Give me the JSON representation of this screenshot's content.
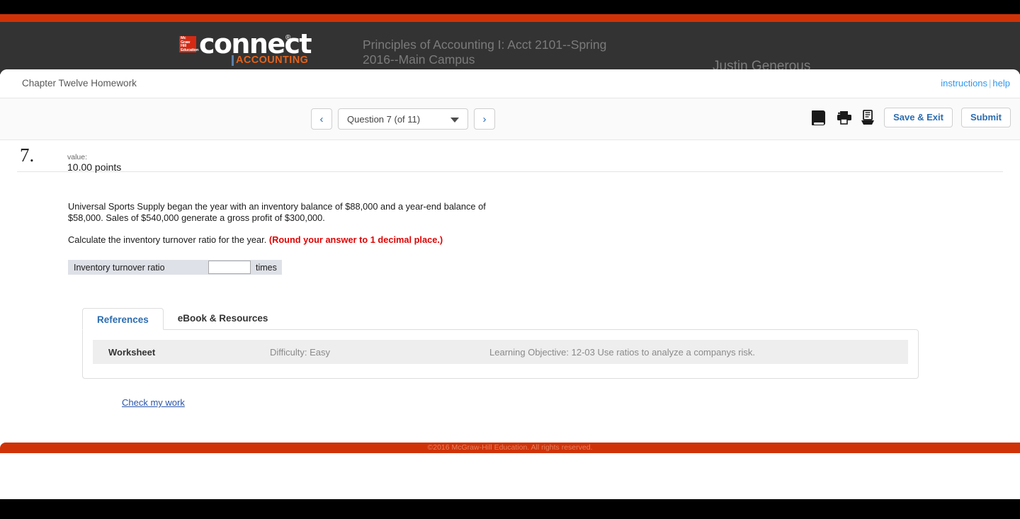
{
  "brand": {
    "publisher_badge": "McGrawHillEducation",
    "product_name": "connect",
    "registered_mark": "®",
    "product_discipline": "ACCOUNTING",
    "accent_orange": "#d03208",
    "header_gray": "#333333",
    "link_blue": "#2b6cb0"
  },
  "header": {
    "course_title": "Principles of Accounting I: Acct 2101--Spring 2016--Main Campus",
    "user_name": "Justin Generous"
  },
  "assignment": {
    "title": "Chapter Twelve Homework",
    "instructions_link": "instructions",
    "separator": "|",
    "help_link": "help"
  },
  "toolbar": {
    "prev_label": "‹",
    "next_label": "›",
    "question_selector": "Question 7 (of 11)",
    "ebook_icon": "book-icon",
    "print_icon": "printer-icon",
    "print_question_icon": "print-tray-icon",
    "save_exit_label": "Save & Exit",
    "submit_label": "Submit"
  },
  "question": {
    "number": "7.",
    "value_label": "value:",
    "value_points": "10.00 points",
    "paragraph_1": "Universal Sports Supply began the year with an inventory balance of $88,000 and a year-end balance of $58,000. Sales of $540,000 generate a gross profit of $300,000.",
    "paragraph_2": "Calculate the inventory turnover ratio for the year.",
    "rounding_note": "(Round your answer to 1 decimal place.)",
    "answer": {
      "label": "Inventory turnover ratio",
      "value": "",
      "placeholder": "",
      "unit": "times"
    },
    "check_my_work": "Check my work"
  },
  "tabs": {
    "items": [
      {
        "label": "References",
        "active": true
      },
      {
        "label": "eBook & Resources",
        "active": false
      }
    ],
    "references": {
      "worksheet": "Worksheet",
      "difficulty": "Difficulty: Easy",
      "learning_objective": "Learning Objective: 12-03 Use ratios to analyze a companys risk."
    }
  },
  "footer": {
    "copyright": "©2016 McGraw-Hill Education. All rights reserved."
  }
}
